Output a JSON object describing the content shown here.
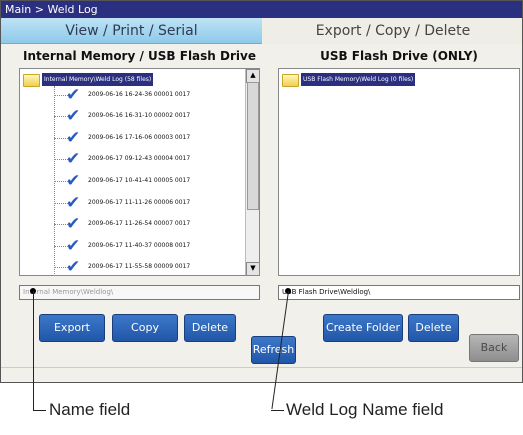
{
  "title_bar": "Main > Weld Log",
  "tabs": [
    {
      "label": "View / Print / Serial",
      "active": true
    },
    {
      "label": "Export / Copy / Delete",
      "active": false
    }
  ],
  "left_panel": {
    "title": "Internal Memory / USB Flash Drive",
    "root_folder": "Internal Memory\\Weld Log (58 files)",
    "items": [
      "2009-06-16  16-24-36  00001  0017",
      "2009-06-16  16-31-10  00002  0017",
      "2009-06-16  17-16-06  00003  0017",
      "2009-06-17  09-12-43  00004  0017",
      "2009-06-17  10-41-41  00005  0017",
      "2009-06-17  11-11-26  00006  0017",
      "2009-06-17  11-26-54  00007  0017",
      "2009-06-17  11-40-37  00008  0017",
      "2009-06-17  11-55-58  00009  0017"
    ],
    "name_field": "Internal Memory\\Weldlog\\"
  },
  "right_panel": {
    "title": "USB Flash Drive (ONLY)",
    "root_folder": "USB Flash Memory\\Weld Log (0 files)",
    "name_field": "USB Flash Drive\\Weldlog\\"
  },
  "buttons": {
    "export": "Export",
    "copy": "Copy",
    "delete_left": "Delete",
    "refresh": "Refresh",
    "create_folder": "Create Folder",
    "delete_right": "Delete",
    "back": "Back"
  },
  "scroll": {
    "up_glyph": "▲",
    "down_glyph": "▼"
  },
  "annotations": {
    "name_field": "Name field",
    "weld_log_name_field": "Weld Log Name field"
  },
  "colors": {
    "title_bar": "#2a2f7f",
    "active_tab": "#8ecaea",
    "button": "#2156a9",
    "disabled_button": "#8e8e8e",
    "checkmark": "#2a5bbf"
  }
}
